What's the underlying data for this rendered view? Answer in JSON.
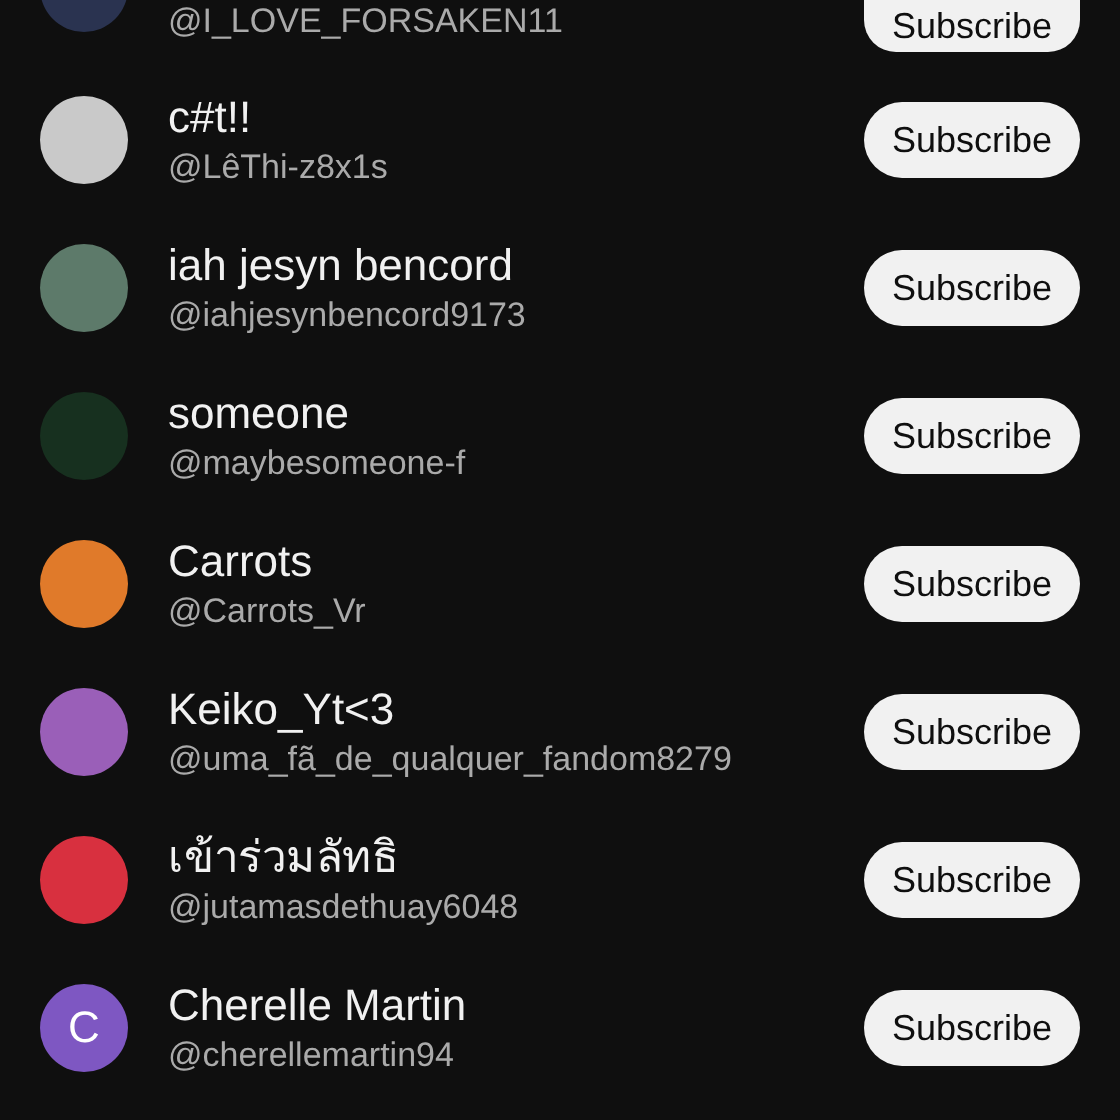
{
  "channels": [
    {
      "kind": "partial",
      "avatar": {
        "kind": "photo",
        "color": "#2a3350"
      },
      "handle": "@I_LOVE_FORSAKEN11",
      "button": "Subscribe"
    },
    {
      "kind": "full",
      "avatar": {
        "kind": "photo",
        "color": "#c9c9c9"
      },
      "name": "c#t!!",
      "handle": "@LêThi-z8x1s",
      "button": "Subscribe"
    },
    {
      "kind": "full",
      "avatar": {
        "kind": "photo",
        "color": "#5d7a6a"
      },
      "name": "iah jesyn bencord",
      "handle": "@iahjesynbencord9173",
      "button": "Subscribe"
    },
    {
      "kind": "full",
      "avatar": {
        "kind": "photo",
        "color": "#17301f"
      },
      "name": "someone",
      "handle": "@maybesomeone-f",
      "button": "Subscribe"
    },
    {
      "kind": "full",
      "avatar": {
        "kind": "photo",
        "color": "#e07a2a"
      },
      "name": "Carrots",
      "handle": "@Carrots_Vr",
      "button": "Subscribe"
    },
    {
      "kind": "full",
      "avatar": {
        "kind": "photo",
        "color": "#9a5fb8"
      },
      "name": "Keiko_Yt<3",
      "handle": "@uma_fã_de_qualquer_fandom8279",
      "button": "Subscribe"
    },
    {
      "kind": "full",
      "avatar": {
        "kind": "photo",
        "color": "#d8303f"
      },
      "name": "เข้าร่วมลัทธิ",
      "handle": "@jutamasdethuay6048",
      "button": "Subscribe"
    },
    {
      "kind": "full",
      "avatar": {
        "kind": "letter",
        "color": "#7e57c2",
        "letter": "C"
      },
      "name": "Cherelle Martin",
      "handle": "@cherellemartin94",
      "button": "Subscribe"
    }
  ]
}
